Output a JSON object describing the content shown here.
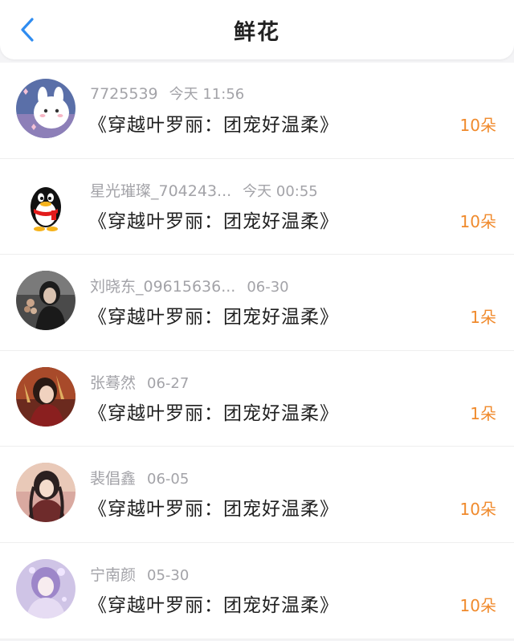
{
  "header": {
    "title": "鲜花",
    "back_icon": "chevron-left-icon",
    "accent_color": "#2f8cf0"
  },
  "gift_color": "#f08a2c",
  "items": [
    {
      "name": "7725539",
      "time": "今天 11:56",
      "book": "《穿越叶罗丽：团宠好温柔》",
      "count": "10朵",
      "avatar": "cartoon-bunny-avatar"
    },
    {
      "name": "星光璀璨_704243...",
      "time": "今天 00:55",
      "book": "《穿越叶罗丽：团宠好温柔》",
      "count": "10朵",
      "avatar": "qq-penguin-avatar"
    },
    {
      "name": "刘晓东_09615636...",
      "time": "06-30",
      "book": "《穿越叶罗丽：团宠好温柔》",
      "count": "1朵",
      "avatar": "photo-avatar"
    },
    {
      "name": "张蓦然",
      "time": "06-27",
      "book": "《穿越叶罗丽：团宠好温柔》",
      "count": "1朵",
      "avatar": "anime-avatar"
    },
    {
      "name": "裴倡鑫",
      "time": "06-05",
      "book": "《穿越叶罗丽：团宠好温柔》",
      "count": "10朵",
      "avatar": "anime-avatar"
    },
    {
      "name": "宁南颜",
      "time": "05-30",
      "book": "《穿越叶罗丽：团宠好温柔》",
      "count": "10朵",
      "avatar": "anime-girl-avatar"
    }
  ]
}
